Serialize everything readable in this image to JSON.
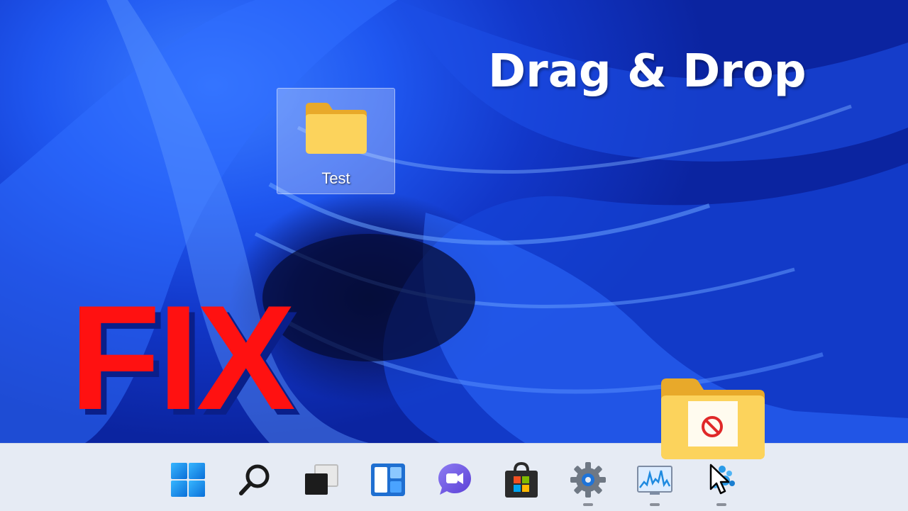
{
  "overlay": {
    "title": "Drag & Drop",
    "fix": "FIX"
  },
  "desktop": {
    "icon_label": "Test",
    "icon": "folder-icon"
  },
  "taskbar": {
    "items": [
      {
        "name": "start",
        "icon": "windows-logo-icon"
      },
      {
        "name": "search",
        "icon": "search-icon"
      },
      {
        "name": "task-view",
        "icon": "task-view-icon"
      },
      {
        "name": "widgets",
        "icon": "widgets-icon"
      },
      {
        "name": "chat",
        "icon": "teams-chat-icon"
      },
      {
        "name": "store",
        "icon": "microsoft-store-icon"
      },
      {
        "name": "settings",
        "icon": "gear-icon",
        "running": true
      },
      {
        "name": "resource-monitor",
        "icon": "performance-monitor-icon",
        "running": true
      },
      {
        "name": "app",
        "icon": "blue-app-icon",
        "running": true
      }
    ]
  },
  "drag": {
    "ghost_icon": "folder-icon",
    "status_icon": "no-drop-icon",
    "cursor": "arrow-cursor-icon"
  },
  "colors": {
    "fix_red": "#ff1111",
    "taskbar_bg": "#e6ebf4",
    "wallpaper_blue": "#1f57f0"
  }
}
